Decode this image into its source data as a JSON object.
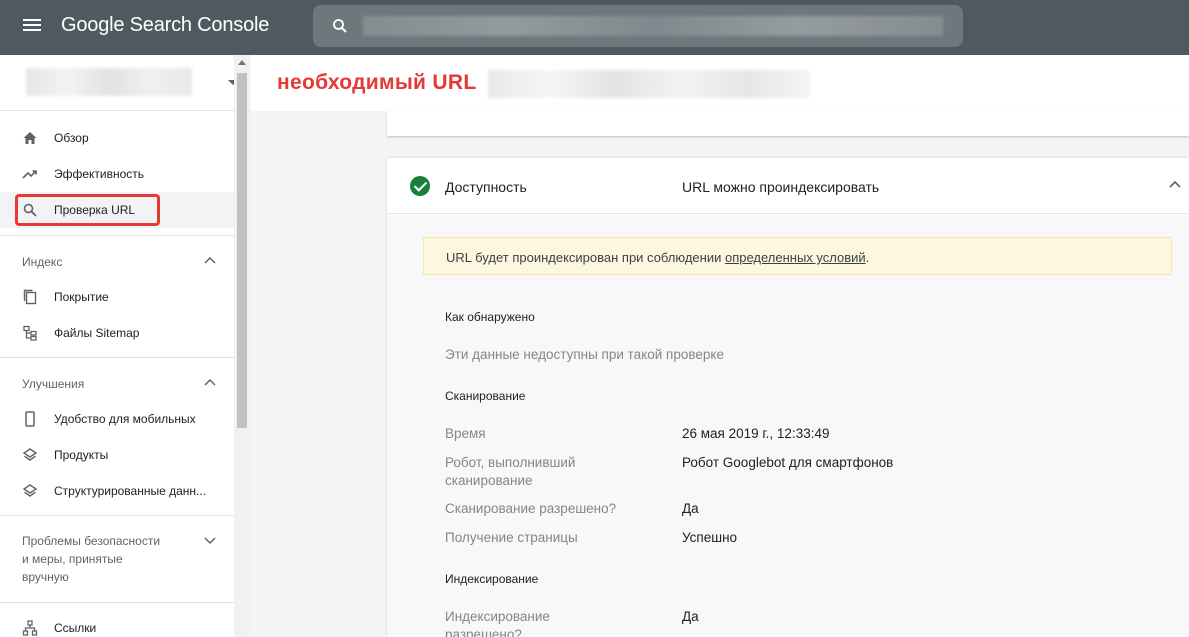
{
  "app": {
    "title": "Google Search Console"
  },
  "sidebar": {
    "items": [
      {
        "label": "Обзор",
        "icon": "home-icon"
      },
      {
        "label": "Эффективность",
        "icon": "trending-up-icon"
      },
      {
        "label": "Проверка URL",
        "icon": "search-icon"
      }
    ],
    "sections": {
      "index": {
        "label": "Индекс",
        "items": [
          {
            "label": "Покрытие",
            "icon": "file-copy-icon"
          },
          {
            "label": "Файлы Sitemap",
            "icon": "sitemap-icon"
          }
        ]
      },
      "enhancements": {
        "label": "Улучшения",
        "items": [
          {
            "label": "Удобство для мобильных",
            "icon": "phone-icon"
          },
          {
            "label": "Продукты",
            "icon": "layers-icon"
          },
          {
            "label": "Структурированные данн...",
            "icon": "layers-icon"
          }
        ]
      },
      "security": {
        "label_lines": [
          "Проблемы безопасности",
          "и меры, принятые",
          "вручную"
        ]
      },
      "links": {
        "label": "Ссылки",
        "icon": "links-icon"
      }
    }
  },
  "header": {
    "url_title": "необходимый URL"
  },
  "card": {
    "title": "Доступность",
    "status": "URL можно проиндексировать",
    "notice": {
      "text_before": "URL будет проиндексирован при соблюдении ",
      "link": "определенных условий",
      "text_after": "."
    },
    "discovery": {
      "heading": "Как обнаружено",
      "note": "Эти данные недоступны при такой проверке"
    },
    "crawl": {
      "heading": "Сканирование",
      "rows": [
        {
          "key": "Время",
          "value": "26 мая 2019 г., 12:33:49"
        },
        {
          "key_lines": [
            "Робот, выполнивший",
            "сканирование"
          ],
          "value": "Робот Googlebot для смартфонов"
        },
        {
          "key": "Сканирование разрешено?",
          "value": "Да"
        },
        {
          "key": "Получение страницы",
          "value": "Успешно"
        }
      ]
    },
    "indexing": {
      "heading": "Индексирование",
      "rows": [
        {
          "key_lines": [
            "Индексирование",
            "разрешено?"
          ],
          "value": "Да"
        }
      ]
    }
  },
  "colors": {
    "topbar": "#4f5a60",
    "accent_red": "#e53935",
    "success_green": "#188038",
    "notice_bg": "#fef7e0"
  }
}
